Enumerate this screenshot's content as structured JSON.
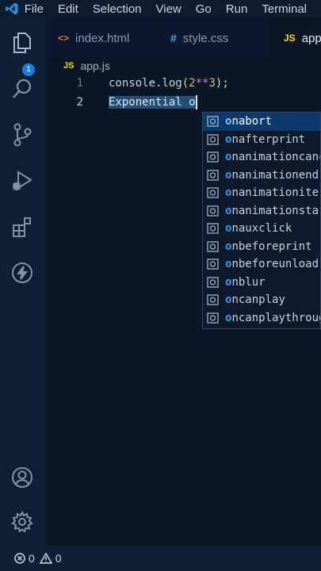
{
  "menu": [
    "File",
    "Edit",
    "Selection",
    "View",
    "Go",
    "Run",
    "Terminal"
  ],
  "activity_bar": {
    "explorer_badge": "1",
    "icons": [
      "files-icon",
      "search-icon",
      "source-control-icon",
      "run-debug-icon",
      "extensions-icon",
      "thunder-icon",
      "account-icon",
      "settings-gear-icon"
    ]
  },
  "tabs": [
    {
      "icon_text": "<>",
      "label": "index.html",
      "kind": "html"
    },
    {
      "icon_text": "#",
      "label": "style.css",
      "kind": "css"
    },
    {
      "icon_text": "JS",
      "label": "app.js",
      "kind": "js",
      "active": true
    }
  ],
  "breadcrumb": {
    "icon_text": "JS",
    "file": "app.js"
  },
  "editor": {
    "lines": [
      {
        "number": "1",
        "text": "console.log(2**3);"
      },
      {
        "number": "2",
        "text": "Exponential o"
      }
    ],
    "line1_tokens": {
      "fn": "console.log(",
      "num1": "2",
      "op": "**",
      "num2": "3",
      "end": ");"
    },
    "line2_selected": "Exponential o"
  },
  "suggestions": {
    "typed_prefix": "o",
    "items": [
      "onabort",
      "onafterprint",
      "onanimationcancel",
      "onanimationend",
      "onanimationiteration",
      "onanimationstart",
      "onauxclick",
      "onbeforeprint",
      "onbeforeunload",
      "onblur",
      "oncanplay",
      "oncanplaythrough"
    ],
    "selected_index": 0
  },
  "statusbar": {
    "errors": "0",
    "warnings": "0"
  },
  "colors": {
    "accent": "#1f7be0",
    "background": "#0c1726",
    "selection": "#264f78"
  }
}
